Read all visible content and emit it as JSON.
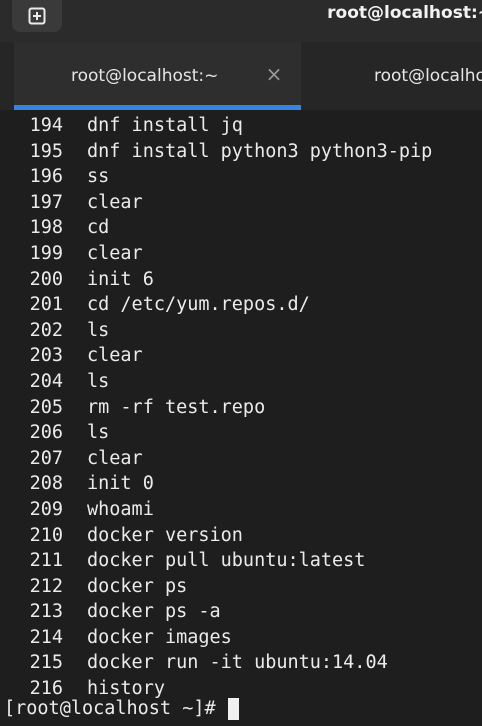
{
  "header": {
    "new_tab_icon": "new-tab-icon",
    "title": "root@localhost:~"
  },
  "tabs": [
    {
      "label": "root@localhost:~",
      "close_symbol": "×",
      "active": true
    },
    {
      "label": "root@localhost:~",
      "active": false
    }
  ],
  "colors": {
    "accent": "#3584e4",
    "background": "#1e1e1e",
    "text": "#ebebeb"
  },
  "terminal": {
    "history": [
      {
        "num": "194",
        "cmd": "dnf install jq"
      },
      {
        "num": "195",
        "cmd": "dnf install python3 python3-pip"
      },
      {
        "num": "196",
        "cmd": "ss"
      },
      {
        "num": "197",
        "cmd": "clear"
      },
      {
        "num": "198",
        "cmd": "cd"
      },
      {
        "num": "199",
        "cmd": "clear"
      },
      {
        "num": "200",
        "cmd": "init 6"
      },
      {
        "num": "201",
        "cmd": "cd /etc/yum.repos.d/"
      },
      {
        "num": "202",
        "cmd": "ls"
      },
      {
        "num": "203",
        "cmd": "clear"
      },
      {
        "num": "204",
        "cmd": "ls"
      },
      {
        "num": "205",
        "cmd": "rm -rf test.repo"
      },
      {
        "num": "206",
        "cmd": "ls"
      },
      {
        "num": "207",
        "cmd": "clear"
      },
      {
        "num": "208",
        "cmd": "init 0"
      },
      {
        "num": "209",
        "cmd": "whoami"
      },
      {
        "num": "210",
        "cmd": "docker version"
      },
      {
        "num": "211",
        "cmd": "docker pull ubuntu:latest"
      },
      {
        "num": "212",
        "cmd": "docker ps"
      },
      {
        "num": "213",
        "cmd": "docker ps -a"
      },
      {
        "num": "214",
        "cmd": "docker images"
      },
      {
        "num": "215",
        "cmd": "docker run -it ubuntu:14.04"
      },
      {
        "num": "216",
        "cmd": "history"
      }
    ],
    "prompt": "[root@localhost ~]#"
  }
}
